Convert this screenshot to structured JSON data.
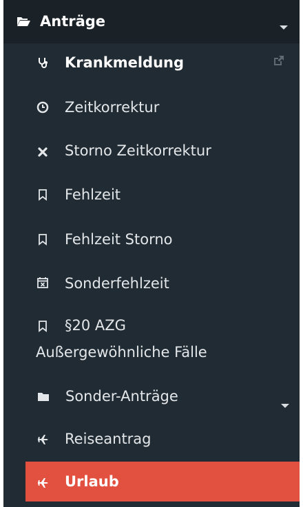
{
  "menu": {
    "title": "Anträge",
    "items": [
      {
        "label": "Krankmeldung",
        "icon": "stethoscope-icon"
      },
      {
        "label": "Zeitkorrektur",
        "icon": "clock-icon"
      },
      {
        "label": "Storno Zeitkorrektur",
        "icon": "close-icon"
      },
      {
        "label": "Fehlzeit",
        "icon": "bookmark-icon"
      },
      {
        "label": "Fehlzeit Storno",
        "icon": "bookmark-icon"
      },
      {
        "label": "Sonderfehlzeit",
        "icon": "calendar-times-icon"
      },
      {
        "label_line1": "§20 AZG",
        "label_line2": "Außergewöhnliche Fälle",
        "icon": "bookmark-icon"
      },
      {
        "label": "Sonder-Anträge",
        "icon": "folder-icon"
      },
      {
        "label": "Reiseantrag",
        "icon": "plane-icon"
      },
      {
        "label": "Urlaub",
        "icon": "plane-icon"
      }
    ]
  },
  "colors": {
    "sidebar_bg": "#212b33",
    "header_bg": "#1a2228",
    "active_bg": "#e2513f",
    "text": "#e3e7ea"
  }
}
